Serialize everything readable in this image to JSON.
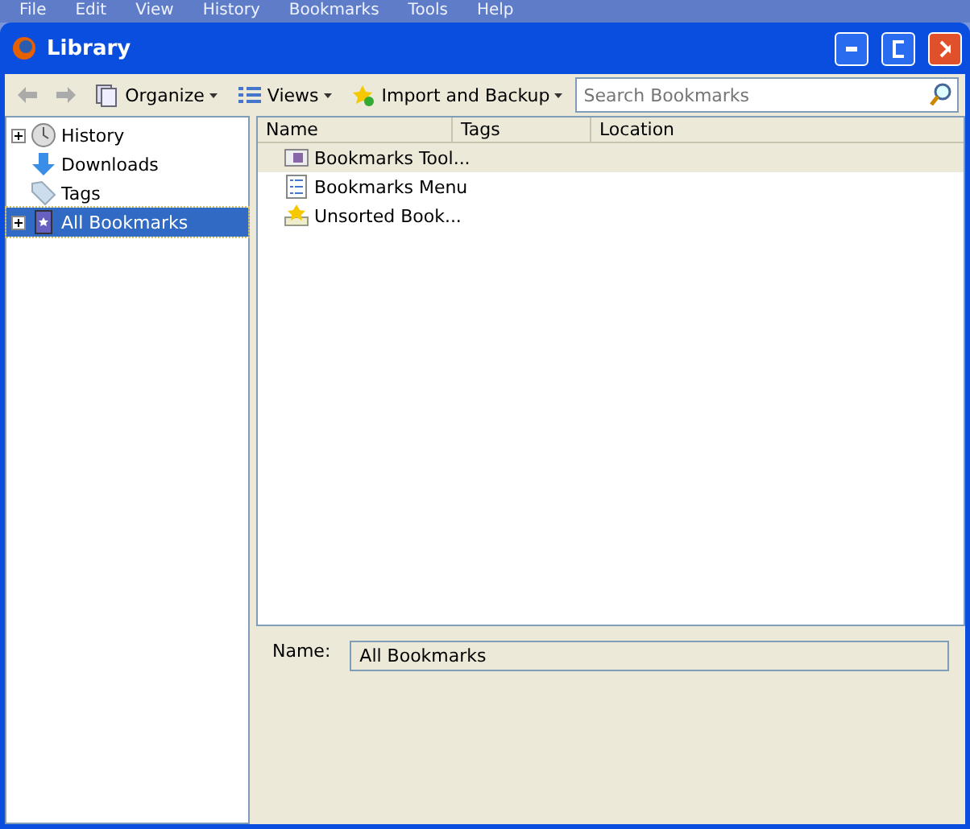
{
  "background_menu": [
    "File",
    "Edit",
    "View",
    "History",
    "Bookmarks",
    "Tools",
    "Help"
  ],
  "window": {
    "title": "Library"
  },
  "toolbar": {
    "items": [
      {
        "kind": "back"
      },
      {
        "kind": "forward"
      },
      {
        "kind": "menu",
        "label": "Organize"
      },
      {
        "kind": "menu",
        "label": "Views"
      },
      {
        "kind": "menu",
        "label": "Import and Backup"
      }
    ],
    "search": {
      "placeholder": "Search Bookmarks"
    }
  },
  "sidebar": {
    "items": [
      {
        "label": "History",
        "expandable": true,
        "selected": false
      },
      {
        "label": "Downloads",
        "expandable": false,
        "selected": false
      },
      {
        "label": "Tags",
        "expandable": false,
        "selected": false
      },
      {
        "label": "All Bookmarks",
        "expandable": true,
        "selected": true
      }
    ]
  },
  "table": {
    "columns": [
      "Name",
      "Tags",
      "Location"
    ],
    "rows": [
      {
        "name": "Bookmarks Tool...",
        "selected": true
      },
      {
        "name": "Bookmarks Menu",
        "selected": false
      },
      {
        "name": "Unsorted Book...",
        "selected": false
      }
    ]
  },
  "details": {
    "label": "Name:",
    "value": "All Bookmarks"
  }
}
